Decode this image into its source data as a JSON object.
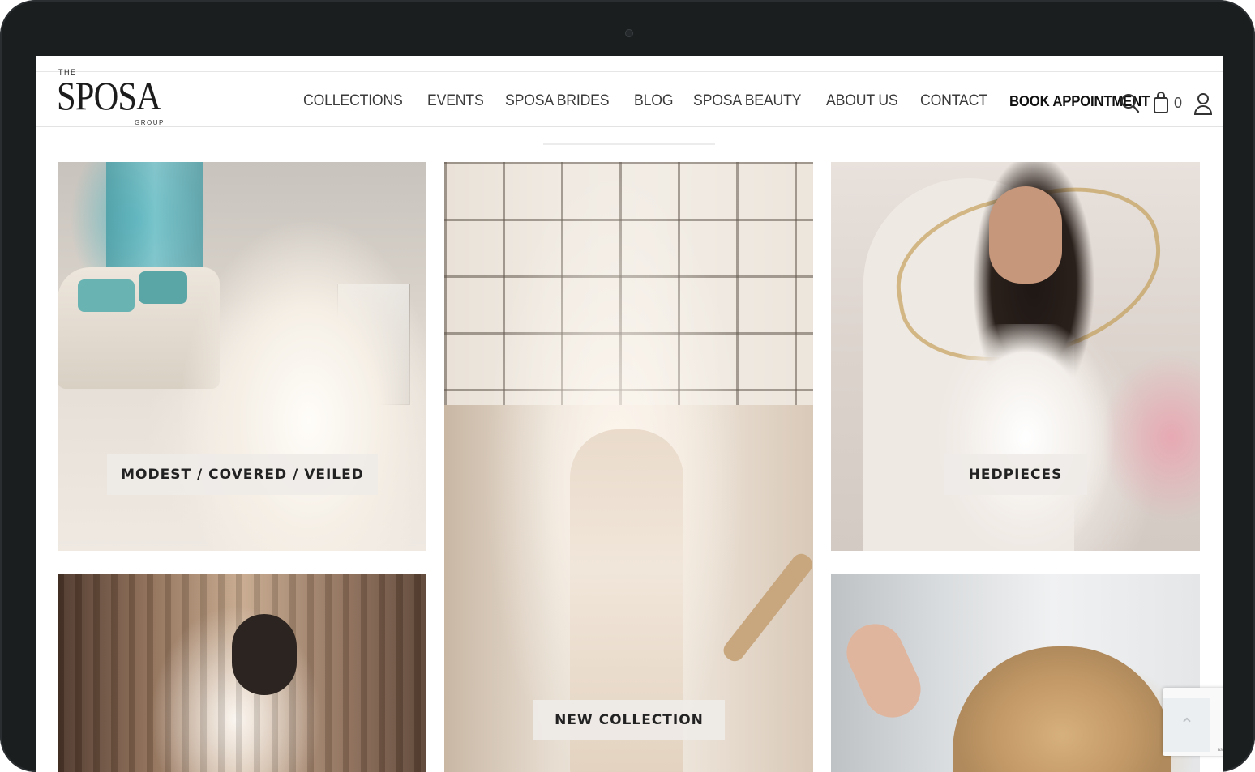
{
  "logo": {
    "top": "THE",
    "main": "SPOSA",
    "bottom": "GROUP"
  },
  "nav": [
    {
      "label": "COLLECTIONS"
    },
    {
      "label": "EVENTS"
    },
    {
      "label": "SPOSA BRIDES"
    },
    {
      "label": "BLOG"
    },
    {
      "label": "SPOSA BEAUTY"
    },
    {
      "label": "ABOUT US"
    },
    {
      "label": "CONTACT"
    },
    {
      "label": "BOOK APPOINTMENT"
    }
  ],
  "header_icons": {
    "search": "search-icon",
    "cart": "shopping-bag-icon",
    "cart_count": "0",
    "account": "user-icon"
  },
  "tiles": [
    {
      "label": "MODEST / COVERED / VEILED"
    },
    {
      "label": "NEW COLLECTION"
    },
    {
      "label": "HEDPIECES"
    }
  ],
  "recaptcha": {
    "fragment": "ns"
  },
  "back_to_top": {
    "icon": "chevron-up-icon",
    "glyph": "⌃"
  }
}
